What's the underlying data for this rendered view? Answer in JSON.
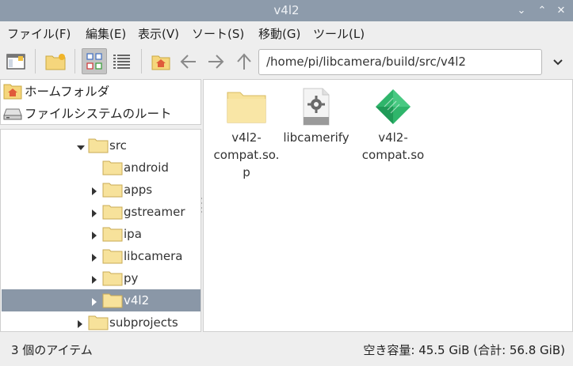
{
  "window": {
    "title": "v4l2"
  },
  "window_controls": {
    "minimize": "⌄",
    "maximize": "⌃",
    "close": "✕"
  },
  "menu": [
    "ファイル(F)",
    "編集(E)",
    "表示(V)",
    "ソート(S)",
    "移動(G)",
    "ツール(L)"
  ],
  "address_bar": {
    "path": "/home/pi/libcamera/build/src/v4l2"
  },
  "places": [
    {
      "label": "ホームフォルダ",
      "icon": "home-folder-icon"
    },
    {
      "label": "ファイルシステムのルート",
      "icon": "drive-icon"
    }
  ],
  "tree": [
    {
      "label": "src",
      "depth": 1,
      "expanded": true,
      "has_children": true,
      "selected": false
    },
    {
      "label": "android",
      "depth": 2,
      "expanded": false,
      "has_children": false,
      "selected": false
    },
    {
      "label": "apps",
      "depth": 2,
      "expanded": false,
      "has_children": true,
      "selected": false
    },
    {
      "label": "gstreamer",
      "depth": 2,
      "expanded": false,
      "has_children": true,
      "selected": false
    },
    {
      "label": "ipa",
      "depth": 2,
      "expanded": false,
      "has_children": true,
      "selected": false
    },
    {
      "label": "libcamera",
      "depth": 2,
      "expanded": false,
      "has_children": true,
      "selected": false
    },
    {
      "label": "py",
      "depth": 2,
      "expanded": false,
      "has_children": true,
      "selected": false
    },
    {
      "label": "v4l2",
      "depth": 2,
      "expanded": false,
      "has_children": true,
      "selected": true
    },
    {
      "label": "subprojects",
      "depth": 1,
      "expanded": false,
      "has_children": true,
      "selected": false
    }
  ],
  "files": [
    {
      "name": "v4l2-\ncompat.so.p",
      "icon": "folder-icon"
    },
    {
      "name": "libcamerify",
      "icon": "script-gear-icon"
    },
    {
      "name": "v4l2-\ncompat.so",
      "icon": "shared-library-icon"
    }
  ],
  "status": {
    "left": "3 個のアイテム",
    "right": "空き容量: 45.5 GiB (合計: 56.8 GiB)"
  },
  "colors": {
    "titlebar": "#8d9bab",
    "selection": "#8a97a7",
    "folder": "#f7e29b"
  }
}
